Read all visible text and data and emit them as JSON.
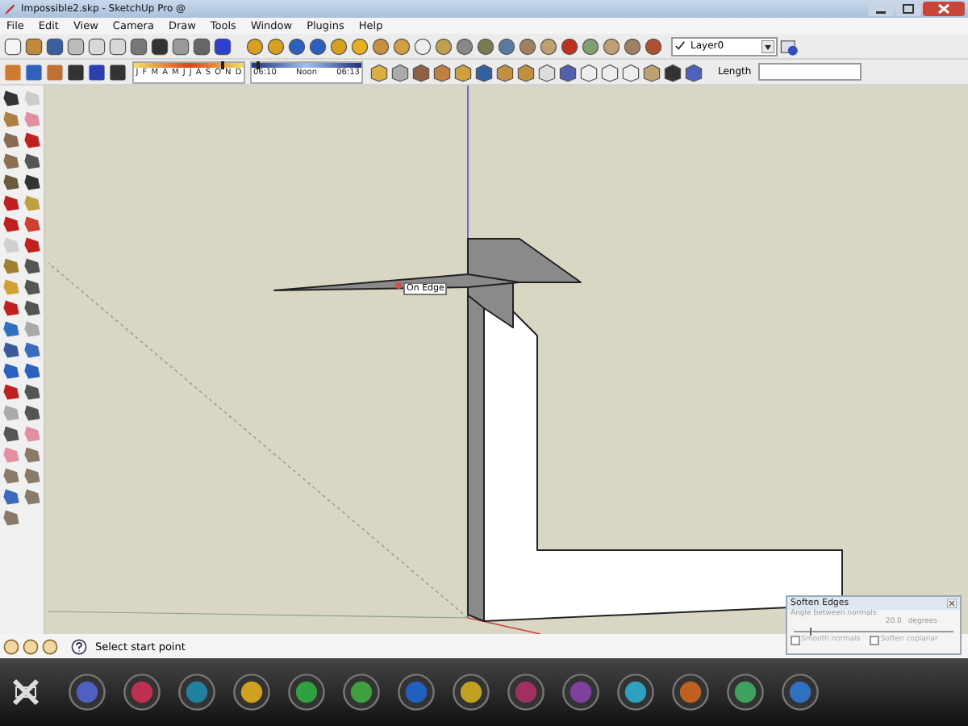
{
  "window": {
    "title": "Impossible2.skp - SketchUp Pro @"
  },
  "menu": [
    "File",
    "Edit",
    "View",
    "Camera",
    "Draw",
    "Tools",
    "Window",
    "Plugins",
    "Help"
  ],
  "toolbar": {
    "months": [
      "J",
      "F",
      "M",
      "A",
      "M",
      "J",
      "J",
      "A",
      "S",
      "O",
      "N",
      "D"
    ],
    "month_slider": {
      "level": 0.8
    },
    "time_slider": {
      "level": 0.05
    },
    "time_start": "06:10",
    "time_noon": "Noon",
    "time_end": "06:13",
    "layer": "Layer0",
    "length_label": "Length"
  },
  "canvas": {
    "tooltip": "On Edge"
  },
  "status_bar": {
    "message": "Select start point"
  },
  "soften_edges": {
    "title": "Soften Edges",
    "angle_label": "Angle between normals:",
    "angle_value": "20.0",
    "unit": "degrees",
    "level": 0.1,
    "options": [
      {
        "label": "Smooth normals",
        "checked": false,
        "disabled": true
      },
      {
        "label": "Soften coplanar",
        "checked": false,
        "disabled": true
      }
    ]
  }
}
